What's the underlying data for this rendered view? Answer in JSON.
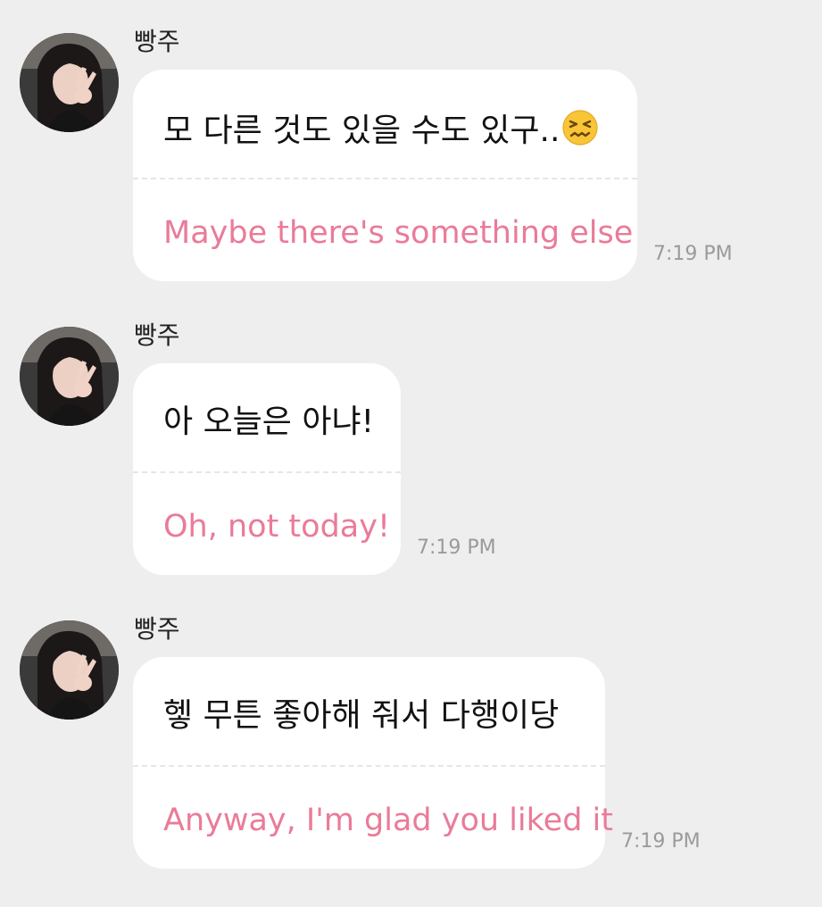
{
  "messages": [
    {
      "sender": "빵주",
      "original": "모 다른 것도 있을 수도 있구..",
      "emoji": "confounded-face-icon",
      "translation": "Maybe there's something else",
      "time": "7:19 PM"
    },
    {
      "sender": "빵주",
      "original": "아 오늘은 아냐!",
      "translation": "Oh, not today!",
      "time": "7:19 PM"
    },
    {
      "sender": "빵주",
      "original": "헿 무튼 좋아해 줘서 다행이당",
      "translation": "Anyway, I'm glad you liked it",
      "time": "7:19 PM"
    }
  ],
  "colors": {
    "background": "#eeeeee",
    "bubble": "#ffffff",
    "translation_text": "#ea7b98",
    "timestamp": "#9a9a9a"
  }
}
